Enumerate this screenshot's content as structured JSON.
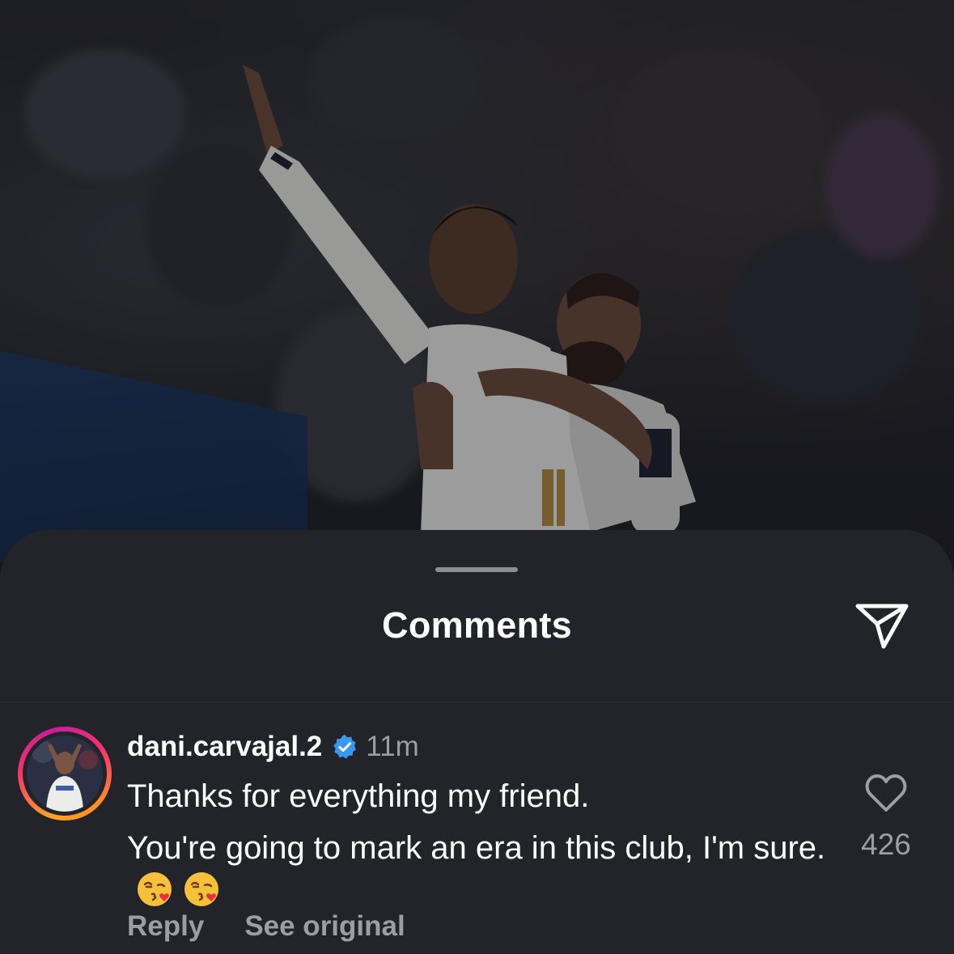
{
  "post": {
    "photo_alt_icon": "celebration-photo"
  },
  "sheet": {
    "title": "Comments",
    "share_icon": "paper-plane-icon"
  },
  "comment": {
    "username": "dani.carvajal.2",
    "verified_icon": "verified-badge-icon",
    "time": "11m",
    "line1": "Thanks for everything my friend.",
    "line2": "You're going to mark an era in this club, I'm sure.",
    "emojis": [
      "kissing-face-with-heart-emoji",
      "kissing-face-with-heart-emoji"
    ],
    "like_icon": "heart-outline-icon",
    "like_count": "426",
    "reply_label": "Reply",
    "see_original_label": "See original"
  },
  "colors": {
    "sheet_bg": "#232429",
    "secondary_text": "#9c9ea4",
    "verified_blue": "#3897f0",
    "story_ring": [
      "#f9a426",
      "#f5326e",
      "#c41e9b"
    ]
  }
}
